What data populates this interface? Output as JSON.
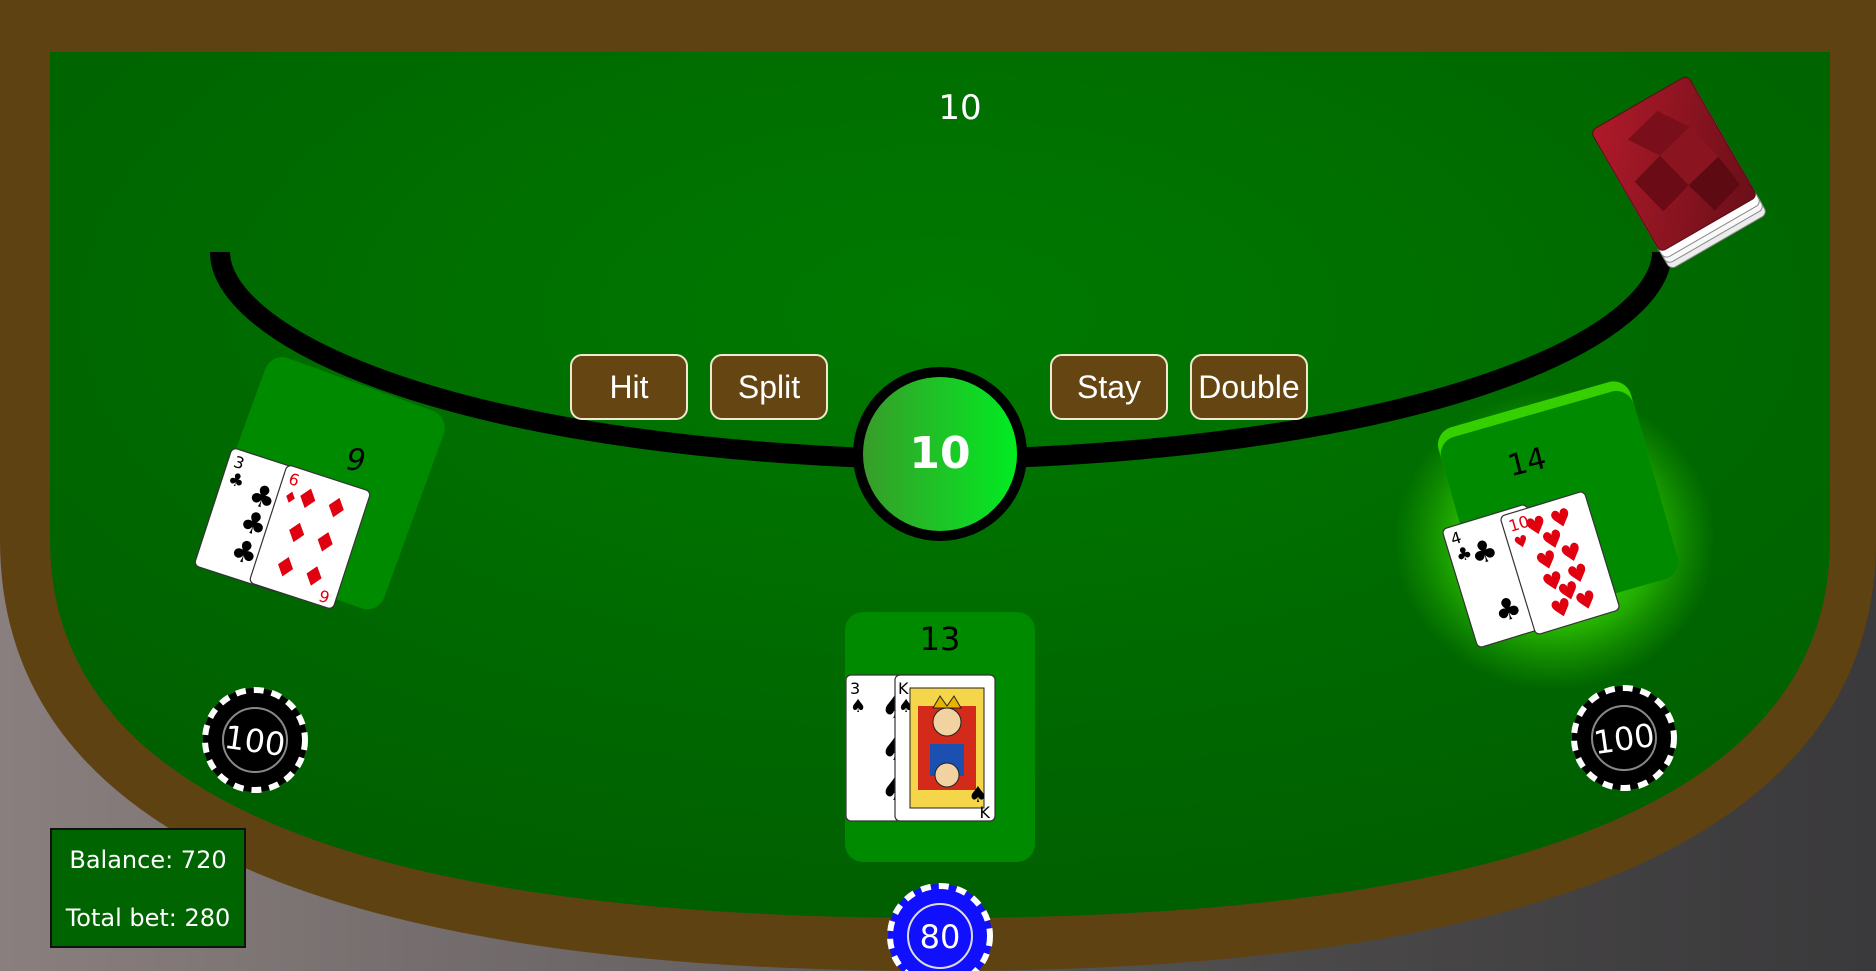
{
  "dealer": {
    "score": "10"
  },
  "center": {
    "value": "10"
  },
  "buttons": {
    "hit": "Hit",
    "split": "Split",
    "stay": "Stay",
    "double": "Double"
  },
  "hands": [
    {
      "score": "9",
      "cards": [
        {
          "rank": "3",
          "suit": "clubs"
        },
        {
          "rank": "6",
          "suit": "diamonds"
        }
      ],
      "bet": "100"
    },
    {
      "score": "13",
      "cards": [
        {
          "rank": "3",
          "suit": "spades"
        },
        {
          "rank": "K",
          "suit": "spades"
        }
      ],
      "bet": "80"
    },
    {
      "score": "14",
      "cards": [
        {
          "rank": "4",
          "suit": "clubs"
        },
        {
          "rank": "10",
          "suit": "hearts"
        }
      ],
      "bet": "100",
      "active": true
    }
  ],
  "status": {
    "balance": "Balance: 720",
    "total_bet": "Total bet: 280"
  },
  "colors": {
    "felt": "#007000",
    "rail": "#5f4211",
    "button_bg": "#654512",
    "active_glow": "#4cff00",
    "chip_black": "#000000",
    "chip_blue": "#1010ff"
  }
}
